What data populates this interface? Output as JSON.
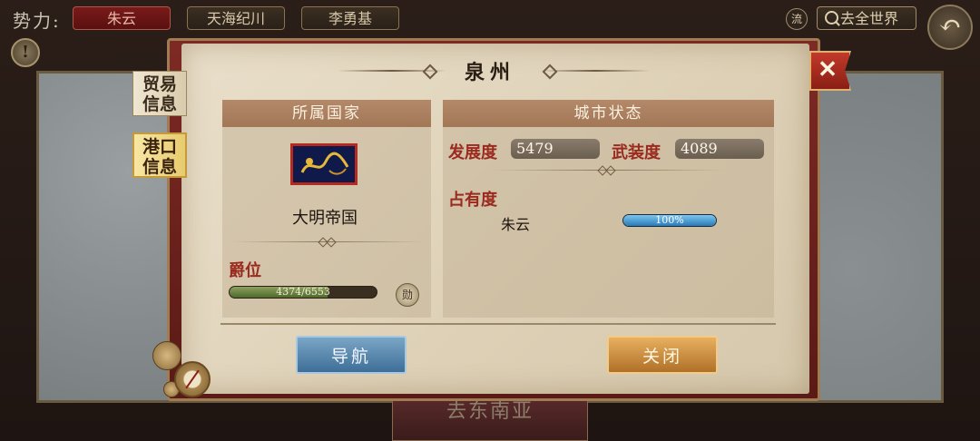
{
  "topbar": {
    "faction_label": "势力:",
    "factions": [
      "朱云",
      "天海纪川",
      "李勇基"
    ],
    "liu_label": "流",
    "world_button": "去全世界",
    "back_icon": "back-arrow-icon",
    "alert_icon": "exclamation-icon"
  },
  "background": {
    "bottom_label": "去东南亚"
  },
  "dialog": {
    "title": "泉州",
    "close_icon": "close-x-icon",
    "side_tabs": {
      "trade": [
        "贸易",
        "信息"
      ],
      "port": [
        "港口",
        "信息"
      ]
    },
    "country_panel": {
      "header": "所属国家",
      "flag_icon": "dragon-flag-icon",
      "country": "大明帝国",
      "rank_label": "爵位",
      "rank_value": "4374/6553",
      "rank_progress": 0.667,
      "medal_icon_text": "勋"
    },
    "city_panel": {
      "header": "城市状态",
      "development_label": "发展度",
      "development_value": "5479",
      "armament_label": "武装度",
      "armament_value": "4089",
      "occupation_label": "占有度",
      "occupation_owner": "朱云",
      "occupation_value": "100%",
      "occupation_progress": 1.0
    },
    "buttons": {
      "navigate": "导航",
      "close": "关闭"
    }
  },
  "colors": {
    "accent_red": "#9a2a1e",
    "nav_blue": "#3e6e98",
    "close_gold": "#b07028"
  }
}
